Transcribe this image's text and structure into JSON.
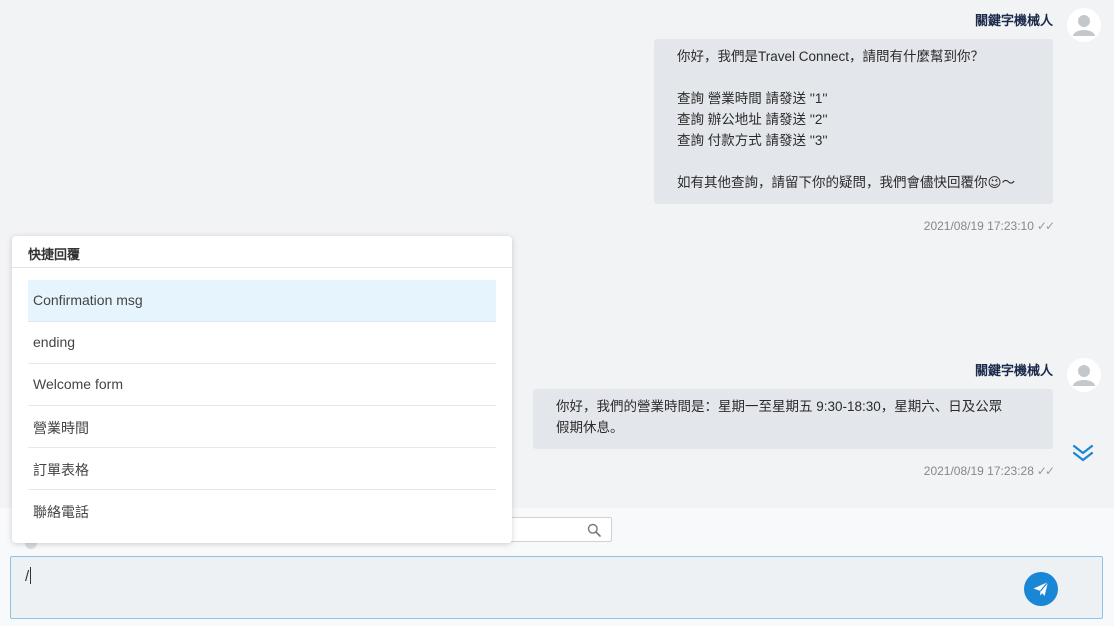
{
  "messages": [
    {
      "sender": "關鍵字機械人",
      "text": "你好，我們是Travel Connect，請問有什麼幫到你？\n\n查詢 營業時間 請發送 ''1''\n查詢 辦公地址 請發送 ''2''\n查詢 付款方式 請發送 ''3''\n\n如有其他查詢，請留下你的疑問，我們會儘快回覆你😉～",
      "timestamp": "2021/08/19 17:23:10",
      "status": "✓✓"
    },
    {
      "sender": "關鍵字機械人",
      "text": "你好，我們的營業時間是：星期一至星期五 9:30-18:30，星期六、日及公眾\n假期休息。",
      "timestamp": "2021/08/19 17:23:28",
      "status": "✓✓"
    }
  ],
  "quick_reply": {
    "title": "快捷回覆",
    "items": [
      {
        "label": "Confirmation msg",
        "selected": true
      },
      {
        "label": "ending",
        "selected": false
      },
      {
        "label": "Welcome form",
        "selected": false
      },
      {
        "label": "營業時間",
        "selected": false
      },
      {
        "label": "訂單表格",
        "selected": false
      },
      {
        "label": "聯絡電話",
        "selected": false
      }
    ]
  },
  "composer": {
    "value": "/"
  },
  "colors": {
    "accent": "#1a86d6",
    "selected_item": "#e6f5fd",
    "bubble": "#e3e6ea"
  },
  "icons": {
    "avatar": "user-avatar-icon",
    "scroll": "double-chevron-down-icon",
    "search": "search-icon",
    "send": "paper-plane-icon"
  }
}
